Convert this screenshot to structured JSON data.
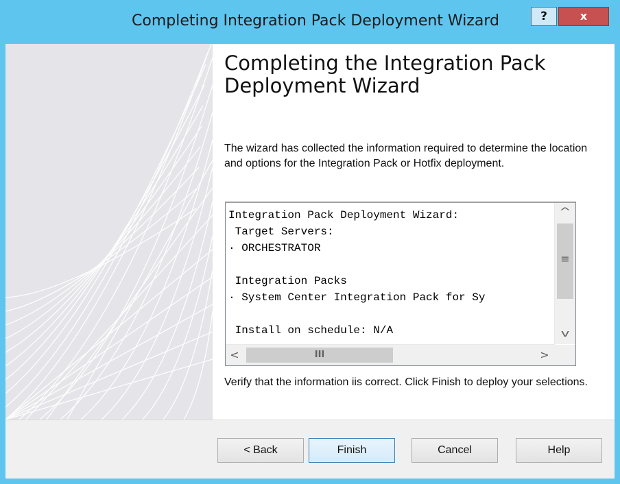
{
  "window": {
    "title": "Completing Integration Pack Deployment Wizard",
    "help_glyph": "?",
    "close_glyph": "x",
    "colors": {
      "titlebar": "#5ec5ef",
      "close": "#c75050"
    }
  },
  "content": {
    "heading": "Completing the Integration Pack Deployment Wizard",
    "description": "The wizard has collected the information required to determine the location and options for the Integration Pack or Hotfix deployment.",
    "summary_lines": [
      "Integration Pack Deployment Wizard:",
      " Target Servers:",
      "· ORCHESTRATOR",
      "",
      " Integration Packs",
      "· System Center Integration Pack for Sy",
      "",
      " Install on schedule: N/A"
    ],
    "verify_text": "Verify that the information iis correct.  Click Finish to deploy your selections."
  },
  "scrollbars": {
    "up_glyph": "^",
    "down_glyph": "v",
    "left_glyph": "<",
    "right_glyph": ">",
    "vgrip_glyph": "≡",
    "hgrip_glyph": "III"
  },
  "buttons": {
    "back": "< Back",
    "finish": "Finish",
    "cancel": "Cancel",
    "help": "Help"
  }
}
